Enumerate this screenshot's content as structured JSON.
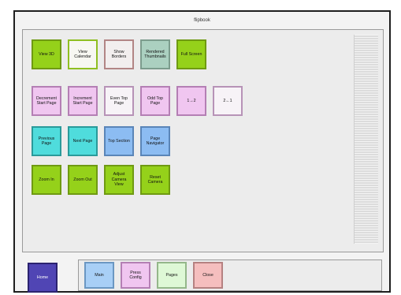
{
  "window": {
    "title": "flipbook"
  },
  "rows": {
    "row1": [
      {
        "label": "View 3D",
        "style": "c-green"
      },
      {
        "label": "View Calendar",
        "style": "c-white-green"
      },
      {
        "label": "Show Borders",
        "style": "c-white-red"
      },
      {
        "label": "Rendered Thumbnails",
        "style": "c-sage"
      },
      {
        "label": "Full Screen",
        "style": "c-green"
      }
    ],
    "row2": [
      {
        "label": "Decrement Start Page",
        "style": "c-pink"
      },
      {
        "label": "Increment Start Page",
        "style": "c-pink"
      },
      {
        "label": "Even Top Page",
        "style": "c-white-pink"
      },
      {
        "label": "Odd Top Page",
        "style": "c-pink"
      },
      {
        "label": "1→2",
        "style": "c-pink"
      },
      {
        "label": "2←1",
        "style": "c-white-pink"
      }
    ],
    "row3": [
      {
        "label": "Previous Page",
        "style": "c-cyan"
      },
      {
        "label": "Next Page",
        "style": "c-cyan"
      },
      {
        "label": "Top Section",
        "style": "c-blue"
      },
      {
        "label": "Page Navigator",
        "style": "c-blue"
      }
    ],
    "row4": [
      {
        "label": "Zoom In",
        "style": "c-green"
      },
      {
        "label": "Zoom Out",
        "style": "c-green"
      },
      {
        "label": "Adjust Camera View",
        "style": "c-green"
      },
      {
        "label": "Reset Camera",
        "style": "c-green"
      }
    ]
  },
  "bottom": {
    "home": "Home",
    "tabs": [
      {
        "label": "Main",
        "style": "c-lightblue"
      },
      {
        "label": "Press Config",
        "style": "c-pink"
      },
      {
        "label": "Pages",
        "style": "c-mint"
      },
      {
        "label": "Close",
        "style": "c-salmon"
      }
    ]
  }
}
